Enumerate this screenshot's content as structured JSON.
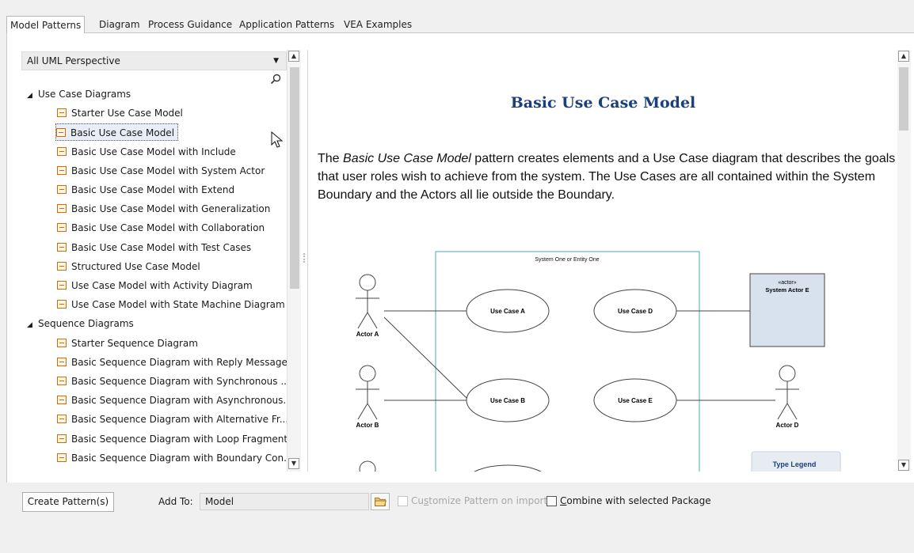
{
  "tabs": [
    "Model Patterns",
    "Diagram",
    "Process Guidance",
    "Application Patterns",
    "VEA Examples"
  ],
  "perspective": "All UML Perspective",
  "tree": [
    {
      "type": "group",
      "label": "Use Case Diagrams"
    },
    {
      "type": "item",
      "label": "Starter Use Case Model"
    },
    {
      "type": "item",
      "label": "Basic Use Case Model",
      "selected": true
    },
    {
      "type": "item",
      "label": "Basic Use Case Model with Include"
    },
    {
      "type": "item",
      "label": "Basic Use Case Model with System Actor"
    },
    {
      "type": "item",
      "label": "Basic Use Case Model with Extend"
    },
    {
      "type": "item",
      "label": "Basic Use Case Model with Generalization"
    },
    {
      "type": "item",
      "label": "Basic Use Case Model with Collaboration"
    },
    {
      "type": "item",
      "label": "Basic Use Case Model with Test Cases"
    },
    {
      "type": "item",
      "label": "Structured Use Case Model"
    },
    {
      "type": "item",
      "label": "Use Case Model with Activity Diagram"
    },
    {
      "type": "item",
      "label": "Use Case Model with State Machine Diagram"
    },
    {
      "type": "group",
      "label": "Sequence Diagrams"
    },
    {
      "type": "item",
      "label": "Starter Sequence Diagram"
    },
    {
      "type": "item",
      "label": "Basic Sequence Diagram with Reply Message"
    },
    {
      "type": "item",
      "label": "Basic Sequence Diagram with Synchronous ..."
    },
    {
      "type": "item",
      "label": "Basic Sequence Diagram with Asynchronous..."
    },
    {
      "type": "item",
      "label": "Basic Sequence Diagram with Alternative Fr..."
    },
    {
      "type": "item",
      "label": "Basic Sequence Diagram with Loop Fragment"
    },
    {
      "type": "item",
      "label": "Basic Sequence Diagram with Boundary Con..."
    }
  ],
  "content": {
    "title": "Basic Use Case Model",
    "desc_before": "The ",
    "desc_italic": "Basic Use Case Model",
    "desc_after": " pattern creates elements and a Use Case diagram that describes the goals that user roles wish to achieve from the system. The Use Cases are all contained within the System Boundary and the Actors all lie outside the Boundary."
  },
  "diagram": {
    "boundary_label": "System One or Entity One",
    "use_cases": [
      "Use Case A",
      "Use Case D",
      "Use Case B",
      "Use Case E"
    ],
    "actors": [
      "Actor A",
      "Actor B",
      "Actor D"
    ],
    "system_actor_stereotype": "«actor»",
    "system_actor_name": "System Actor E",
    "legend_title": "Type Legend"
  },
  "bottom": {
    "create_button": "Create Pattern(s)",
    "add_to_label": "Add To:",
    "add_to_value": "Model",
    "customize_pre": "Cu",
    "customize_ul": "s",
    "customize_post": "tomize Pattern on import",
    "combine_ul": "C",
    "combine_post": "ombine with selected Package"
  }
}
